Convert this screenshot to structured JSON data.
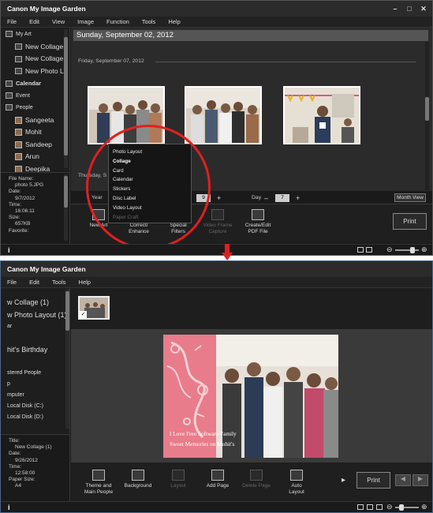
{
  "win1": {
    "title": "Canon My Image Garden",
    "menu": [
      "File",
      "Edit",
      "View",
      "Image",
      "Function",
      "Tools",
      "Help"
    ],
    "sidebar": [
      {
        "label": "My Art",
        "kind": "header-icon"
      },
      {
        "label": "New Collage",
        "kind": "art"
      },
      {
        "label": "New Collage",
        "kind": "art"
      },
      {
        "label": "New Photo L",
        "kind": "art"
      },
      {
        "label": "Calendar",
        "kind": "bold"
      },
      {
        "label": "Event",
        "kind": "small"
      },
      {
        "label": "People",
        "kind": "small"
      },
      {
        "label": "Sangeeta",
        "kind": "person"
      },
      {
        "label": "Mohit",
        "kind": "person"
      },
      {
        "label": "Sandeep",
        "kind": "person"
      },
      {
        "label": "Arun",
        "kind": "person"
      },
      {
        "label": "Deepika",
        "kind": "person"
      }
    ],
    "info": {
      "file_name_label": "File Name:",
      "file_name": "photo 5.JPG",
      "date_label": "Date:",
      "date": "9/7/2012",
      "time_label": "Time:",
      "time": "16:06:11",
      "size_label": "Size:",
      "size": "657KB",
      "favorite_label": "Favorite:"
    },
    "date_header": "Sunday, September 02, 2012",
    "day1": "Friday, September 07, 2012",
    "day2": "Thursday, S",
    "popup": [
      "Photo Layout",
      "Collage",
      "Card",
      "Calendar",
      "Stickers",
      "Disc Label",
      "Video Layout",
      "Paper Craft"
    ],
    "nav": {
      "year_label": "Year",
      "month_value": "9",
      "day_label": "Day",
      "day_value": "7",
      "month_view": "Month View"
    },
    "tools": [
      {
        "label": "New Art",
        "enabled": true
      },
      {
        "label": "Correct/\nEnhance",
        "enabled": true
      },
      {
        "label": "Special\nFilters",
        "enabled": true
      },
      {
        "label": "Video Frame\nCapture",
        "enabled": false
      },
      {
        "label": "Create/Edit\nPDF File",
        "enabled": true
      }
    ],
    "print": "Print"
  },
  "win2": {
    "title": "Canon My Image Garden",
    "menu": [
      "File",
      "Edit",
      "Tools",
      "Help"
    ],
    "sidebar": [
      {
        "label": "w Collage (1)",
        "size": "big"
      },
      {
        "label": "w Photo Layout (1)",
        "size": "big"
      },
      {
        "label": "ar",
        "size": "small"
      },
      {
        "label": "",
        "size": "small"
      },
      {
        "label": "hit's Birthday",
        "size": "big"
      },
      {
        "label": "",
        "size": "small"
      },
      {
        "label": "stered People",
        "size": "small"
      },
      {
        "label": "p",
        "size": "small"
      },
      {
        "label": "mputer",
        "size": "small"
      },
      {
        "label": "Local Disk (C:)",
        "size": "small"
      },
      {
        "label": "Local Disk (D:)",
        "size": "small"
      }
    ],
    "info": {
      "title_label": "Title:",
      "title": "New Collage (1)",
      "date_label": "Date:",
      "date": "9/26/2012",
      "time_label": "Time:",
      "time": "12:58:00",
      "paper_size_label": "Paper Size:",
      "paper_size": "A4"
    },
    "caption_line1": "I Love Free Software Family",
    "caption_line2": "Sweet Memories on Mohit's",
    "tools": [
      {
        "label": "Theme and\nMain People",
        "enabled": true
      },
      {
        "label": "Background",
        "enabled": true
      },
      {
        "label": "Layout",
        "enabled": false
      },
      {
        "label": "Add Page",
        "enabled": true
      },
      {
        "label": "Delete Page",
        "enabled": false
      },
      {
        "label": "Auto\nLayout",
        "enabled": true
      }
    ],
    "print": "Print"
  }
}
